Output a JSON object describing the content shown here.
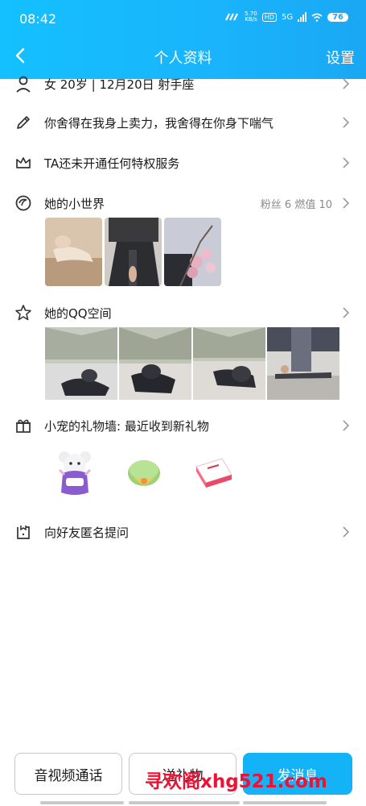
{
  "status_bar": {
    "time": "08:42",
    "network_speed": "5.70",
    "speed_unit": "KB/s",
    "hd_badge": "HD",
    "network_type": "5G",
    "battery": "76"
  },
  "header": {
    "title": "个人资料",
    "settings_label": "设置"
  },
  "profile": {
    "info_line": "女  20岁  |  12月20日  射手座",
    "signature": "你舍得在我身上卖力，我舍得在你身下喘气",
    "privilege": "TA还未开通任何特权服务",
    "small_world": {
      "label": "她的小世界",
      "stats": "粉丝 6  燃值 10"
    },
    "qzone_label": "她的QQ空间",
    "gift_wall_label": "小宠的礼物墙: 最近收到新礼物",
    "anonymous_question_label": "向好友匿名提问"
  },
  "bottom_bar": {
    "call_label": "音视频通话",
    "gift_label": "送礼物",
    "message_label": "发消息"
  },
  "watermark": "寻欢阁xhg521.com",
  "colors": {
    "header_gradient_start": "#14c0ff",
    "header_gradient_end": "#1aa7f4",
    "primary_button": "#14b2f7",
    "watermark": "#ee1133"
  }
}
